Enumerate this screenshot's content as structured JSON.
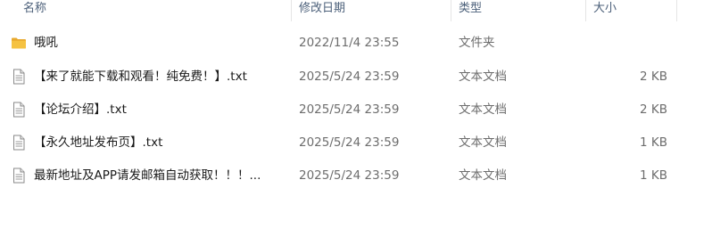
{
  "columns": {
    "name": "名称",
    "date_modified": "修改日期",
    "type": "类型",
    "size": "大小"
  },
  "files": [
    {
      "name": "哦吼",
      "date": "2022/11/4 23:55",
      "type": "文件夹",
      "size": "",
      "icon": "folder-icon"
    },
    {
      "name": "【来了就能下载和观看！纯免费！】.txt",
      "date": "2025/5/24 23:59",
      "type": "文本文档",
      "size": "2 KB",
      "icon": "text-file-icon"
    },
    {
      "name": "【论坛介绍】.txt",
      "date": "2025/5/24 23:59",
      "type": "文本文档",
      "size": "2 KB",
      "icon": "text-file-icon"
    },
    {
      "name": "【永久地址发布页】.txt",
      "date": "2025/5/24 23:59",
      "type": "文本文档",
      "size": "1 KB",
      "icon": "text-file-icon"
    },
    {
      "name": "最新地址及APP请发邮箱自动获取！！！...",
      "date": "2025/5/24 23:59",
      "type": "文本文档",
      "size": "1 KB",
      "icon": "text-file-icon"
    }
  ],
  "colors": {
    "folder": "#f5c242",
    "header_text": "#4c607a",
    "secondary_text": "#6d6d6d"
  }
}
